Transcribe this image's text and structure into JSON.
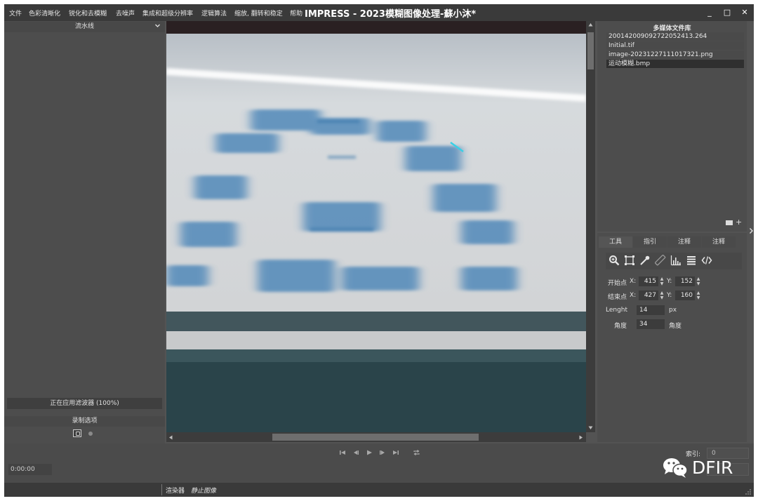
{
  "menu": {
    "items": [
      "文件",
      "色彩清晰化",
      "锐化和去模糊",
      "去噪声",
      "集成和超级分辨率",
      "逻辑算法",
      "缩放, 翻转和稳定",
      "帮助"
    ],
    "app_title": "IMPRESS - 2023模糊图像处理-蘇小沐*"
  },
  "window": {
    "minimize_glyph": "_",
    "maximize_glyph": "□",
    "close_glyph": "✕"
  },
  "left_panel": {
    "pipeline_title": "流水线",
    "filter_status": "正在应用滤波器 (100%)",
    "record_title": "录制选项"
  },
  "media_library": {
    "title": "多媒体文件库",
    "files": [
      "2001420090927220524​13.264",
      "Initial.tif",
      "image-20231227111017321.png",
      "运动模糊.bmp"
    ],
    "selected_index": 3
  },
  "tools": {
    "tabs": [
      "工具",
      "指引",
      "注释",
      "注释"
    ],
    "active_tab": 0,
    "icons": [
      "zoom-icon",
      "crop-icon",
      "eyedropper-icon",
      "ruler-icon",
      "histogram-icon",
      "layers-icon",
      "code-icon"
    ],
    "start_label": "开始点",
    "end_label": "结束点",
    "x_label": "X:",
    "y_label": "Y:",
    "start_x": "415",
    "start_y": "152",
    "end_x": "427",
    "end_y": "160",
    "length_label": "Lenght",
    "length_value": "14",
    "length_unit": "px",
    "angle_label": "角度",
    "angle_value": "34",
    "angle_unit": "角度"
  },
  "transport": {
    "time": "0:00:00",
    "index_label": "索引:",
    "index_value": "0",
    "watermark": "DFIR"
  },
  "status": {
    "renderer_label": "渲染器",
    "renderer_value": "静止图像"
  },
  "colors": {
    "panel": "#4d4d4d",
    "menubar": "#3a3a3a",
    "accent_selected": "#2f2f2f",
    "measure_line": "#39d0e6"
  }
}
